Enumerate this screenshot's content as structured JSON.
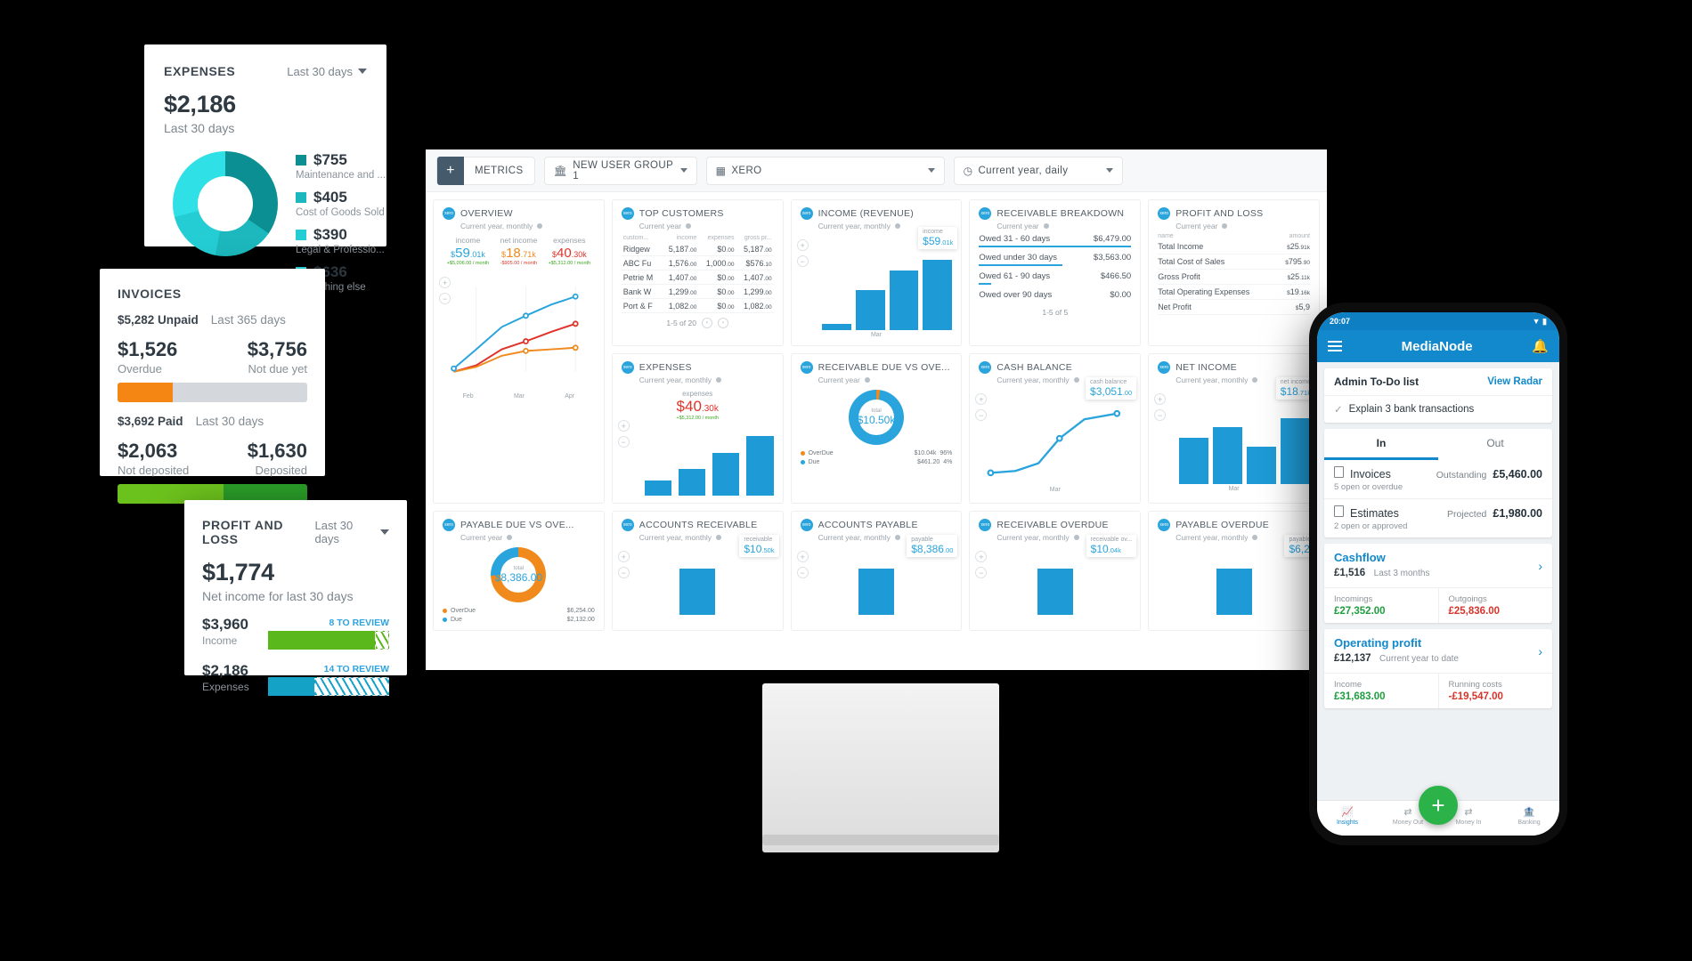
{
  "expenses_card": {
    "title": "EXPENSES",
    "range": "Last 30 days",
    "total": "$2,186",
    "total_label": "Last 30 days",
    "legend": [
      {
        "value": "$755",
        "label": "Maintenance and ...",
        "color": "#0b8f92"
      },
      {
        "value": "$405",
        "label": "Cost of Goods Sold",
        "color": "#1cb8bd"
      },
      {
        "value": "$390",
        "label": "Legal & Professio...",
        "color": "#24cdd4"
      },
      {
        "value": "$636",
        "label": "Everything else",
        "color": "#2fe0e6"
      }
    ]
  },
  "invoices_card": {
    "title": "INVOICES",
    "unpaid": "$5,282 Unpaid",
    "unpaid_range": "Last 365 days",
    "overdue_value": "$1,526",
    "overdue_label": "Overdue",
    "notdue_value": "$3,756",
    "notdue_label": "Not due yet",
    "overdue_color": "#f58613",
    "notdue_color": "#d4d8dc",
    "paid": "$3,692 Paid",
    "paid_range": "Last 30 days",
    "notdeposited_value": "$2,063",
    "notdeposited_label": "Not deposited",
    "deposited_value": "$1,630",
    "deposited_label": "Deposited",
    "notdeposited_color": "#6cc21d",
    "deposited_color": "#2a9c28"
  },
  "pnl_card": {
    "title": "PROFIT AND LOSS",
    "range": "Last 30 days",
    "net": "$1,774",
    "net_label": "Net income for last 30 days",
    "income_value": "$3,960",
    "income_label": "Income",
    "income_review": "8 TO REVIEW",
    "income_color": "#5ab81c",
    "expenses_value": "$2,186",
    "expenses_label": "Expenses",
    "expenses_review": "14 TO REVIEW",
    "expenses_color": "#14a3c7"
  },
  "monitor": {
    "toolbar": {
      "add_label": "METRICS",
      "group_label": "NEW USER GROUP 1",
      "source_label": "XERO",
      "period_label": "Current year, daily",
      "bank_icon": "bank-icon",
      "grid_icon": "grid-icon",
      "clock_icon": "clock-icon"
    },
    "widgets": {
      "overview": {
        "title": "OVERVIEW",
        "subtitle": "Current year, monthly",
        "metrics": [
          {
            "label": "income",
            "value": "59",
            "cents": ".01k",
            "delta": "+$5,006.00 / month",
            "color": "#29a4dc",
            "dcolor": "#3aa81d"
          },
          {
            "label": "net income",
            "value": "18",
            "cents": ".71k",
            "delta": "-$905.00 / month",
            "color": "#f08a1d",
            "dcolor": "#d63b2f"
          },
          {
            "label": "expenses",
            "value": "40",
            "cents": ".30k",
            "delta": "+$5,312.00 / month",
            "color": "#e0342a",
            "dcolor": "#3aa81d"
          }
        ],
        "axis": [
          "Feb",
          "Mar",
          "Apr"
        ]
      },
      "top_customers": {
        "title": "TOP CUSTOMERS",
        "subtitle": "Current year",
        "columns": [
          "custom...",
          "income",
          "expenses",
          "gross pr..."
        ],
        "rows": [
          {
            "name": "Ridgew",
            "income": "5,187",
            "income_c": ".00",
            "expenses": "$0",
            "expenses_c": ".00",
            "gross": "5,187",
            "gross_c": ".00"
          },
          {
            "name": "ABC Fu",
            "income": "1,576",
            "income_c": ".00",
            "expenses": "1,000",
            "expenses_c": ".00",
            "gross": "$576",
            "gross_c": ".10"
          },
          {
            "name": "Petrie M",
            "income": "1,407",
            "income_c": ".00",
            "expenses": "$0",
            "expenses_c": ".00",
            "gross": "1,407",
            "gross_c": ".00"
          },
          {
            "name": "Bank W",
            "income": "1,299",
            "income_c": ".00",
            "expenses": "$0",
            "expenses_c": ".00",
            "gross": "1,299",
            "gross_c": ".00"
          },
          {
            "name": "Port & F",
            "income": "1,082",
            "income_c": ".00",
            "expenses": "$0",
            "expenses_c": ".00",
            "gross": "1,082",
            "gross_c": ".00"
          }
        ],
        "pagination": "1-5 of 20"
      },
      "income_revenue": {
        "title": "INCOME (REVENUE)",
        "subtitle": "Current year, monthly",
        "tip_label": "income",
        "tip_value": "59",
        "tip_cents": ".01k",
        "axis": "Mar",
        "bars": [
          8,
          52,
          78,
          92
        ]
      },
      "receivable_breakdown": {
        "title": "RECEIVABLE BREAKDOWN",
        "subtitle": "Current year",
        "rows": [
          {
            "label": "Owed 31 - 60 days",
            "amount": "$6,479.00",
            "bar": 100
          },
          {
            "label": "Owed under 30 days",
            "amount": "$3,563.00",
            "bar": 55
          },
          {
            "label": "Owed 61 - 90 days",
            "amount": "$466.50",
            "bar": 8
          },
          {
            "label": "Owed over 90 days",
            "amount": "$0.00",
            "bar": 0
          }
        ],
        "pagination": "1-5 of 5"
      },
      "profit_and_loss": {
        "title": "PROFIT AND LOSS",
        "subtitle": "Current year",
        "columns": [
          "name",
          "amount"
        ],
        "rows": [
          {
            "name": "Total Income",
            "amount": "25",
            "cents": ".91k"
          },
          {
            "name": "Total Cost of Sales",
            "amount": "795",
            "cents": ".90"
          },
          {
            "name": "Gross Profit",
            "amount": "25",
            "cents": ".11k"
          },
          {
            "name": "Total Operating Expenses",
            "amount": "19",
            "cents": ".16k"
          },
          {
            "name": "Net Profit",
            "amount": "5,9",
            "cents": ""
          }
        ]
      },
      "expenses_w": {
        "title": "EXPENSES",
        "subtitle": "Current year, monthly",
        "tip_label": "expenses",
        "tip_value": "40",
        "tip_cents": ".30k",
        "tip_delta": "+$5,312.00 / month",
        "bars": [
          22,
          38,
          62,
          86
        ]
      },
      "receivable_due": {
        "title": "RECEIVABLE DUE VS OVE...",
        "subtitle": "Current year",
        "center_label": "total",
        "center_value": "$10.50k",
        "legend": [
          {
            "name": "OverDue",
            "amount": "$10.04k",
            "pct": "96%",
            "color": "#f08a1d"
          },
          {
            "name": "Due",
            "amount": "$461.20",
            "pct": "4%",
            "color": "#29a4dc"
          }
        ]
      },
      "cash_balance": {
        "title": "CASH BALANCE",
        "subtitle": "Current year, monthly",
        "tip_label": "cash balance",
        "tip_value": "3,051",
        "tip_cents": ".00",
        "axis": "Mar"
      },
      "net_income": {
        "title": "NET INCOME",
        "subtitle": "Current year, monthly",
        "tip_label": "net income",
        "tip_value": "18",
        "tip_cents": ".71k",
        "axis": "Mar",
        "bars": [
          62,
          76,
          50,
          88
        ]
      },
      "payable_due": {
        "title": "PAYABLE DUE VS OVE...",
        "subtitle": "Current year",
        "center_label": "total",
        "center_value": "$8,386.00",
        "legend": [
          {
            "name": "OverDue",
            "amount": "$6,254.00",
            "color": "#f08a1d"
          },
          {
            "name": "Due",
            "amount": "$2,132.00",
            "color": "#29a4dc"
          }
        ]
      },
      "accounts_receivable": {
        "title": "ACCOUNTS RECEIVABLE",
        "subtitle": "Current year, monthly",
        "tip_label": "receivable",
        "tip_value": "10",
        "tip_cents": ".50k"
      },
      "accounts_payable": {
        "title": "ACCOUNTS PAYABLE",
        "subtitle": "Current year, monthly",
        "tip_label": "payable",
        "tip_value": "8,386",
        "tip_cents": ".00"
      },
      "receivable_overdue": {
        "title": "RECEIVABLE OVERDUE",
        "subtitle": "Current year, monthly",
        "tip_label": "receivable ov...",
        "tip_value": "10",
        "tip_cents": ".04k"
      },
      "payable_overdue": {
        "title": "PAYABLE OVERDUE",
        "subtitle": "Current year, monthly",
        "tip_label": "payable",
        "tip_value": "6,2",
        "tip_cents": ""
      }
    }
  },
  "phone": {
    "status_time": "20:07",
    "app_title": "MediaNode",
    "menu_icon": "hamburger-icon",
    "bell_icon": "bell-icon",
    "todo_title": "Admin To-Do list",
    "todo_link": "View Radar",
    "todo_item": "Explain 3 bank transactions",
    "tab_in": "In",
    "tab_out": "Out",
    "invoices": {
      "name": "Invoices",
      "label": "Outstanding",
      "value": "£5,460.00",
      "sub": "5 open or overdue"
    },
    "estimates": {
      "name": "Estimates",
      "label": "Projected",
      "value": "£1,980.00",
      "sub": "2 open or approved"
    },
    "cashflow": {
      "title": "Cashflow",
      "value": "£1,516",
      "period": "Last 3 months",
      "in_label": "Incomings",
      "in_value": "£27,352.00",
      "out_label": "Outgoings",
      "out_value": "£25,836.00"
    },
    "operating_profit": {
      "title": "Operating profit",
      "value": "£12,137",
      "period": "Current year to date",
      "in_label": "Income",
      "in_value": "£31,683.00",
      "out_label": "Running costs",
      "out_value": "-£19,547.00"
    },
    "tabbar": [
      {
        "label": "Insights",
        "icon": "chart-icon",
        "active": true
      },
      {
        "label": "Money Out",
        "icon": "arrows-out-icon",
        "active": false
      },
      {
        "label": "Money In",
        "icon": "arrows-in-icon",
        "active": false
      },
      {
        "label": "Banking",
        "icon": "bank-icon",
        "active": false
      }
    ],
    "fab_icon": "plus-icon",
    "positive_color": "#1e9e3e",
    "negative_color": "#d8342b",
    "accent_color": "#1189cc"
  }
}
